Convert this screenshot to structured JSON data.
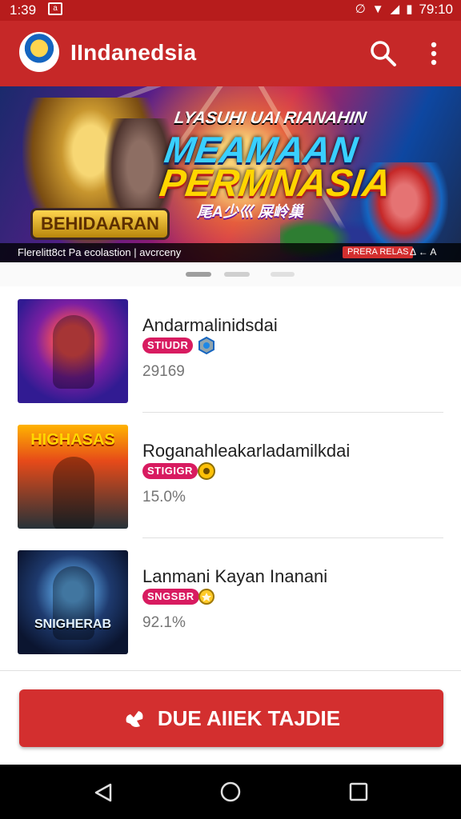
{
  "status_bar": {
    "time": "1:39",
    "clock_right": "79:10",
    "icons": [
      "notification-icon",
      "mute-icon",
      "wifi-icon",
      "signal-icon",
      "battery-icon"
    ]
  },
  "app_bar": {
    "title": "IIndanedsia",
    "icons": [
      "avatar",
      "search-icon",
      "more-vert-icon"
    ],
    "color": "#c62828"
  },
  "banner": {
    "logo_left": "BEHIDAARAN",
    "headline_top": "LYASUHI UAI RIANAHIN",
    "headline_main": "MEAMAAN",
    "headline_sub": "PERMNASIA",
    "headline_small": "尾Α少巛 屎岭巢",
    "caption": "Flerelitt8ct Pa ecolastion | avcrceny",
    "tag": "PRERA RELAS",
    "tag2": "Δ ← Α"
  },
  "pager": {
    "count": 3,
    "active": 0
  },
  "games": [
    {
      "title": "Andarmalinidsdai",
      "badge": "STIUDR",
      "meta": "29169",
      "thumb_label": ""
    },
    {
      "title": "Roganahleakarladamilkdai",
      "badge": "STIGIGR",
      "meta": "15.0%",
      "thumb_label": "HIGHASAS"
    },
    {
      "title": "Lanmani Kayan Inanani",
      "badge": "SNGSBR",
      "meta": "92.1%",
      "thumb_label": "SNIGHERAB"
    }
  ],
  "cta": {
    "label": "DUE AIIEK TAJDIE",
    "color": "#d32f2f"
  },
  "nav_bar": {
    "icons": [
      "back-icon",
      "home-icon",
      "recents-icon"
    ]
  }
}
